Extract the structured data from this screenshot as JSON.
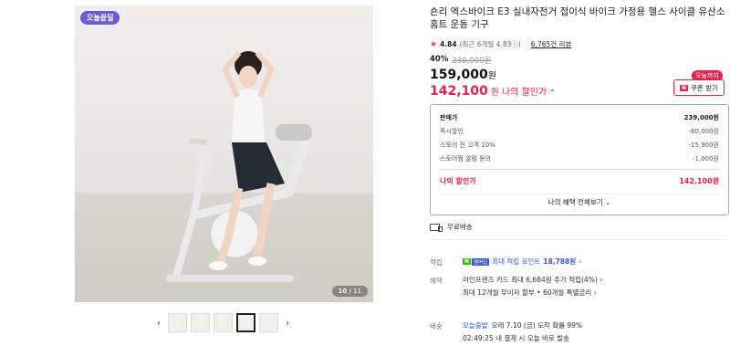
{
  "image": {
    "badge": "오늘끝딜",
    "counter_current": "10",
    "counter_total": "/ 11",
    "prev_arrow": "‹",
    "next_arrow": "›"
  },
  "product": {
    "title": "숀리 엑스바이크 E3 실내자전거 접이식 바이크 가정용 헬스 사이클 유산소 홈트 운동 기구",
    "rating": "4.84",
    "rating_detail": "(최근 6개월 4.83ⓘ)",
    "reviews": "6,765건 리뷰",
    "discount_pct": "40%",
    "original_price": "239,000원",
    "price": "159,000",
    "price_unit": "원",
    "my_price": "142,100",
    "my_price_unit": "원",
    "my_price_label": "나의 할인가",
    "my_price_chevron": "⌃"
  },
  "coupon": {
    "today_tag": "오늘까지",
    "badge": "N",
    "label": "쿠폰 받기"
  },
  "breakdown": {
    "rows": [
      {
        "label": "판매가",
        "value": "239,000원"
      },
      {
        "label": "즉시할인",
        "value": "-80,000원"
      },
      {
        "label": "스토어 전 고객 10%",
        "value": "-15,900원"
      },
      {
        "label": "스토어찜 알림 동의",
        "value": "-1,000원"
      }
    ],
    "final_label": "나의 할인가",
    "final_value": "142,100원",
    "all_benefits": "나의 혜택 전체보기 ⌄"
  },
  "shipping": {
    "label": "무료배송"
  },
  "info": {
    "points_label": "적립",
    "npay_1": "N",
    "npay_2": "멤버십",
    "points_text": "최대 적립 포인트",
    "points_value": "18,788원",
    "points_chevron": "›",
    "benefit_label": "혜택",
    "benefit1": "라인프렌즈 카드 최대 6,684원 추가 적립(4%) ›",
    "benefit2": "최대 12개월 무이자 할부 • 60개월 특별금리 ›",
    "delivery_label": "배송",
    "delivery_fast": "오늘출발",
    "delivery_text": "모레 7.10 (금) 도착 확률 99%",
    "delivery2": "02:49:25  내 결제 시 오늘 바로 발송"
  }
}
